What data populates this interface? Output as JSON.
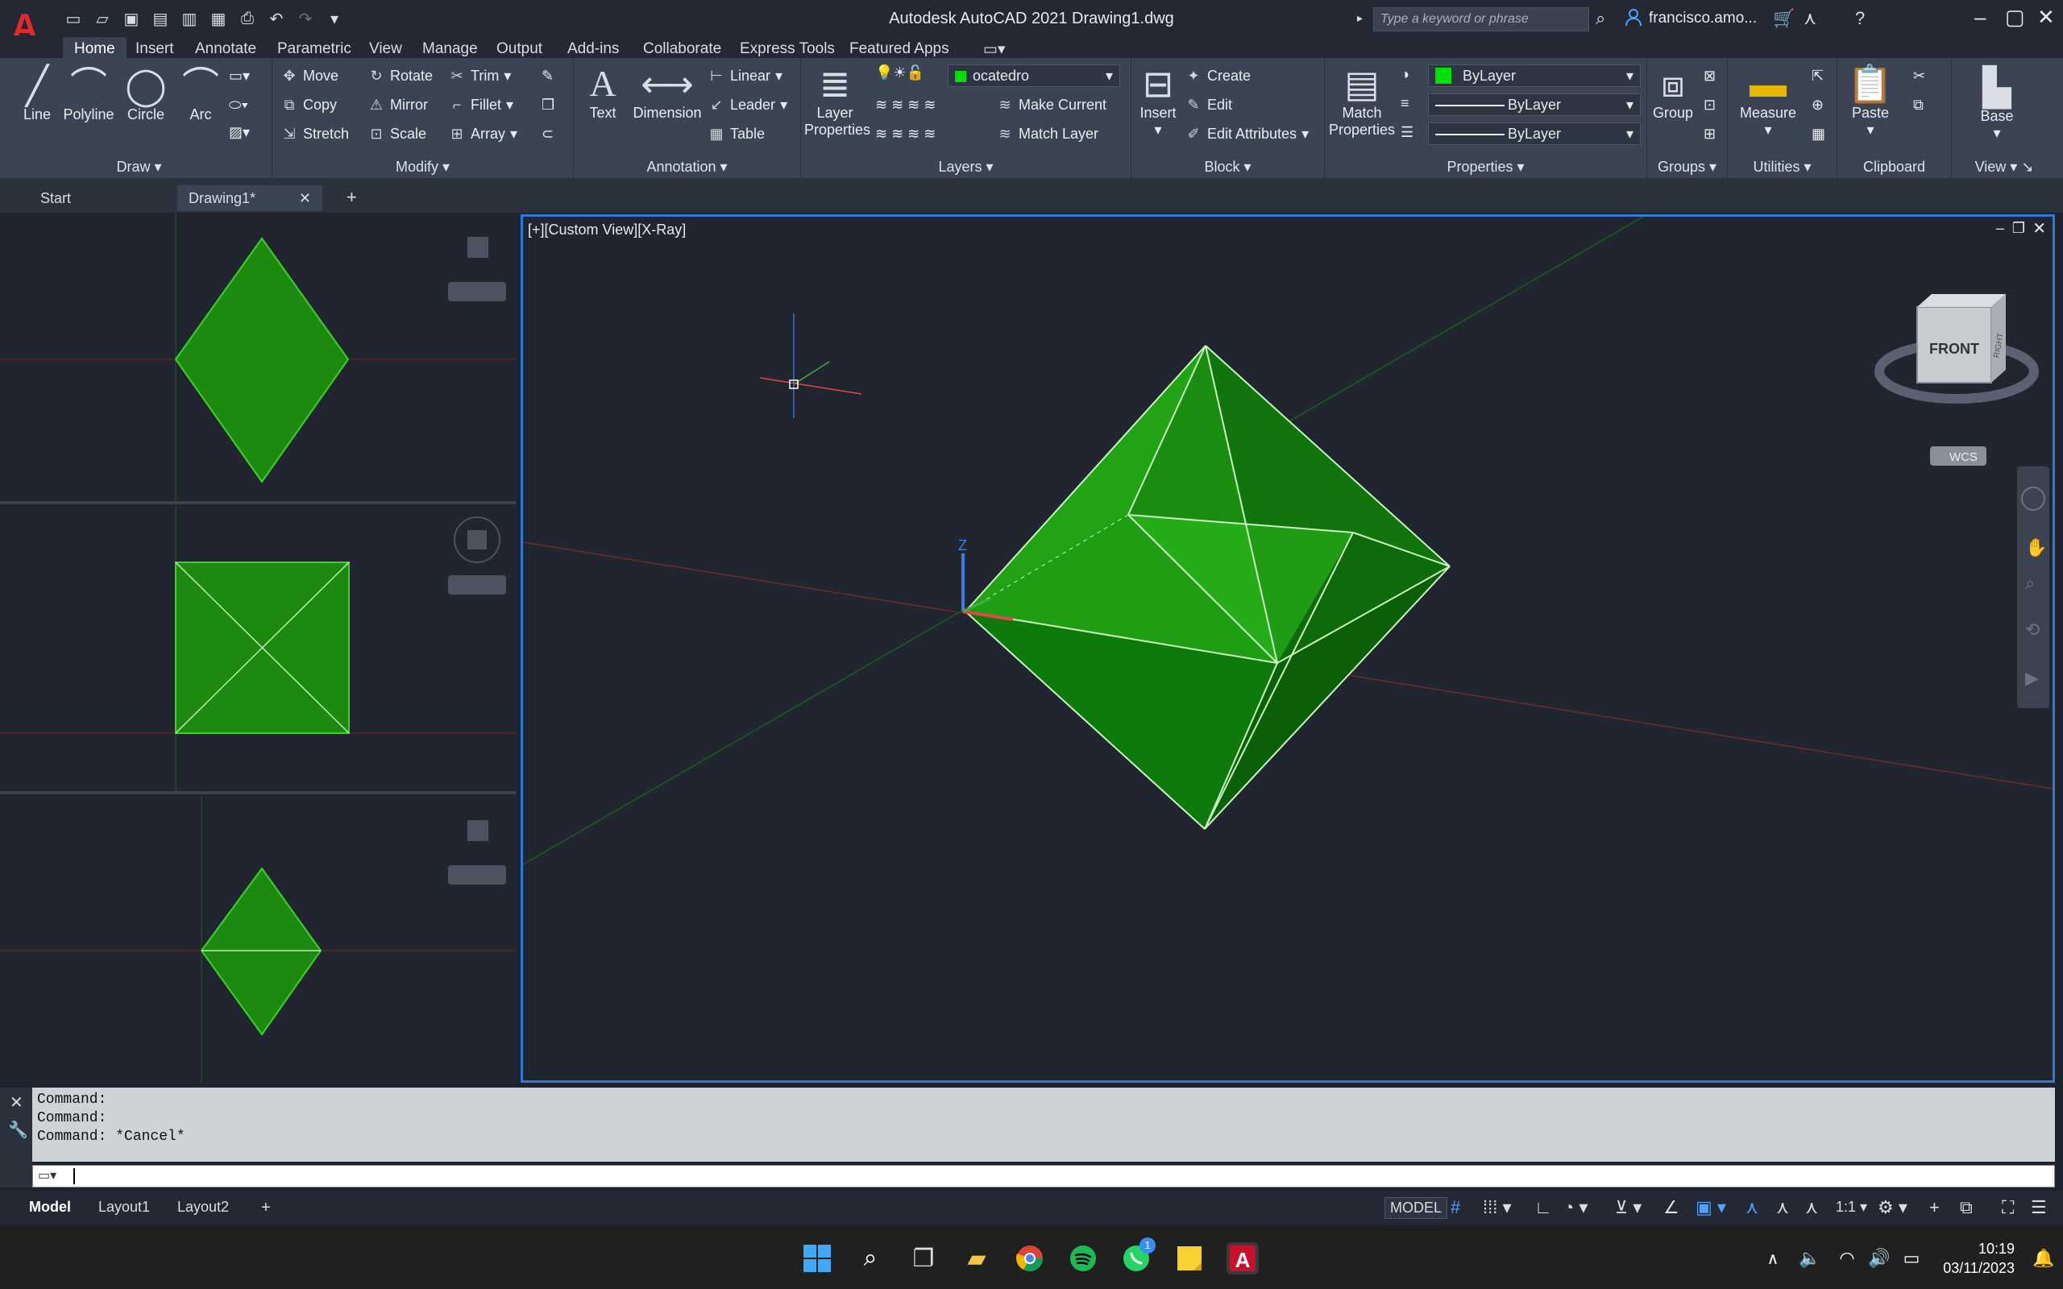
{
  "window": {
    "title": "Autodesk AutoCAD 2021    Drawing1.dwg",
    "search_placeholder": "Type a keyword or phrase",
    "user": "francisco.amo..."
  },
  "menu": {
    "tabs": [
      "Home",
      "Insert",
      "Annotate",
      "Parametric",
      "View",
      "Manage",
      "Output",
      "Add-ins",
      "Collaborate",
      "Express Tools",
      "Featured Apps"
    ]
  },
  "ribbon": {
    "draw": {
      "title": "Draw",
      "line": "Line",
      "polyline": "Polyline",
      "circle": "Circle",
      "arc": "Arc"
    },
    "modify": {
      "title": "Modify",
      "move": "Move",
      "rotate": "Rotate",
      "trim": "Trim",
      "copy": "Copy",
      "mirror": "Mirror",
      "fillet": "Fillet",
      "stretch": "Stretch",
      "scale": "Scale",
      "array": "Array"
    },
    "annotation": {
      "title": "Annotation",
      "text": "Text",
      "dimension": "Dimension",
      "linear": "Linear",
      "leader": "Leader",
      "table": "Table"
    },
    "layers": {
      "title": "Layers",
      "layer_properties_1": "Layer",
      "layer_properties_2": "Properties",
      "current_layer": "ocatedro",
      "make_current": "Make Current",
      "match_layer": "Match Layer"
    },
    "block": {
      "title": "Block",
      "insert": "Insert",
      "create": "Create",
      "edit": "Edit",
      "edit_attributes": "Edit Attributes"
    },
    "properties": {
      "title": "Properties",
      "match_1": "Match",
      "match_2": "Properties",
      "color": "ByLayer",
      "linetype": "ByLayer",
      "lineweight": "ByLayer"
    },
    "groups": {
      "title": "Groups",
      "group": "Group"
    },
    "utilities": {
      "title": "Utilities",
      "measure": "Measure"
    },
    "clipboard": {
      "title": "Clipboard",
      "paste": "Paste"
    },
    "view": {
      "title": "View",
      "base": "Base"
    }
  },
  "doc_tabs": {
    "start": "Start",
    "drawing": "Drawing1*"
  },
  "viewport": {
    "label": "[+][Custom View][X-Ray]",
    "viewcube_front": "FRONT",
    "viewcube_right": "RIGHT",
    "wcs": "WCS",
    "axis_z": "Z"
  },
  "command": {
    "lines": [
      "Command:",
      "Command:",
      "Command: *Cancel*"
    ]
  },
  "layout_tabs": [
    "Model",
    "Layout1",
    "Layout2"
  ],
  "status": {
    "model": "MODEL",
    "scale": "1:1"
  },
  "clock": {
    "time": "10:19",
    "date": "03/11/2023"
  },
  "colors": {
    "accent": "#2f7ad6",
    "solid_green": "#1f9a12",
    "layer_green": "#00ff00"
  },
  "taskbar_badge": "1"
}
